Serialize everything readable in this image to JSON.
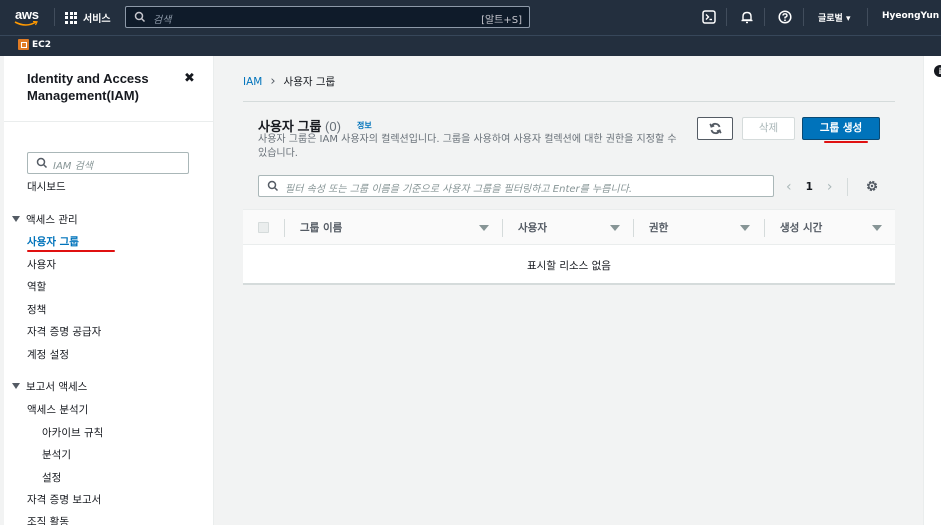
{
  "topbar": {
    "logo": "aws",
    "services_label": "서비스",
    "search_placeholder": "검색",
    "search_shortcut": "[알트+S]",
    "region": "글로벌 ▾",
    "user": "HyeongYun ▾"
  },
  "favorites": {
    "ec2_label": "EC2"
  },
  "sidebar": {
    "title": "Identity and Access Management(IAM)",
    "close": "✖",
    "search_placeholder": "IAM 검색",
    "dashboard": "대시보드",
    "access_mgmt": {
      "label": "액세스 관리",
      "items": [
        "사용자 그룹",
        "사용자",
        "역할",
        "정책",
        "자격 증명 공급자",
        "계정 설정"
      ]
    },
    "report_access": {
      "label": "보고서 액세스",
      "analyzer": "액세스 분석기",
      "sub": [
        "아카이브 규칙",
        "분석기",
        "설정"
      ],
      "credential_report": "자격 증명 보고서",
      "org_activity": "조직 활동"
    }
  },
  "breadcrumb": {
    "root": "IAM",
    "current": "사용자 그룹"
  },
  "panel": {
    "title": "사용자 그룹",
    "count": "(0)",
    "info": "정보",
    "desc": "사용자 그룹은 IAM 사용자의 컬렉션입니다. 그룹을 사용하여 사용자 컬렉션에 대한 권한을 지정할 수 있습니다.",
    "delete": "삭제",
    "create": "그룹 생성",
    "filter_placeholder": "필터 속성 또는 그룹 이름을 기준으로 사용자 그룹을 필터링하고 Enter를 누릅니다.",
    "page": "1",
    "columns": [
      "그룹 이름",
      "사용자",
      "권한",
      "생성 시간"
    ],
    "empty": "표시할 리소스 없음"
  },
  "colors": {
    "nav_bg": "#232f3e",
    "accent": "#0073bb",
    "annotation_red": "#e01010"
  }
}
